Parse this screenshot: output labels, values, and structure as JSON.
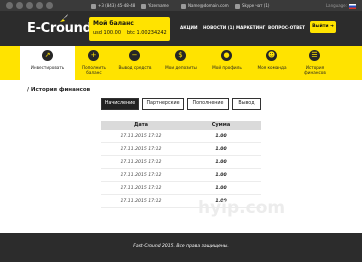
{
  "header": {
    "social_icons": [
      "facebook-icon",
      "twitter-icon",
      "vk-icon",
      "youtube-icon",
      "instagram-icon"
    ],
    "phone": "+3 (843) 45-48-48",
    "skype": "Yizername",
    "email": "Name@domain.com",
    "chat": "Skype чат (1)",
    "language": "Language:",
    "logo": "E-Cround",
    "balance_title": "Мой баланс",
    "balance_usd": "usd 100.00",
    "balance_btc": "btc 1.00234242",
    "nav": [
      "АКЦИИ",
      "НОВОСТИ (1)",
      "МАРКЕТИНГ",
      "ВОПРОС-ОТВЕТ"
    ],
    "login_label": "Выйти ➜"
  },
  "menu": [
    {
      "label": "Инвестировать",
      "icon": "invest-icon",
      "glyph": "↗"
    },
    {
      "label": "Пополнить баланс",
      "icon": "plus-icon",
      "glyph": "+"
    },
    {
      "label": "Вывод средств",
      "icon": "minus-icon",
      "glyph": "−"
    },
    {
      "label": "Мои депозиты",
      "icon": "deposits-icon",
      "glyph": "$"
    },
    {
      "label": "Мой профиль",
      "icon": "profile-icon",
      "glyph": "●"
    },
    {
      "label": "Моя команда",
      "icon": "team-icon",
      "glyph": "☻"
    },
    {
      "label": "История финансов",
      "icon": "history-icon",
      "glyph": "☰"
    }
  ],
  "page_title": "/ История финансов",
  "tabs": [
    "Начисление",
    "Партнерские",
    "Пополнение",
    "Вывод"
  ],
  "table": {
    "headers": [
      "Дата",
      "Сумма"
    ],
    "rows": [
      [
        "17.11.2015 17:12",
        "1.00"
      ],
      [
        "17.11.2015 17:12",
        "1.00"
      ],
      [
        "17.11.2015 17:12",
        "1.00"
      ],
      [
        "17.11.2015 17:12",
        "1.00"
      ],
      [
        "17.11.2015 17:12",
        "1.00"
      ],
      [
        "17.11.2015 17:12",
        "1.00"
      ]
    ]
  },
  "watermark": "hyip.com",
  "footer": "Fast-Cround 2015. Все права защищены.",
  "colors": {
    "accent": "#ffe300",
    "dark": "#2c2c2c"
  }
}
